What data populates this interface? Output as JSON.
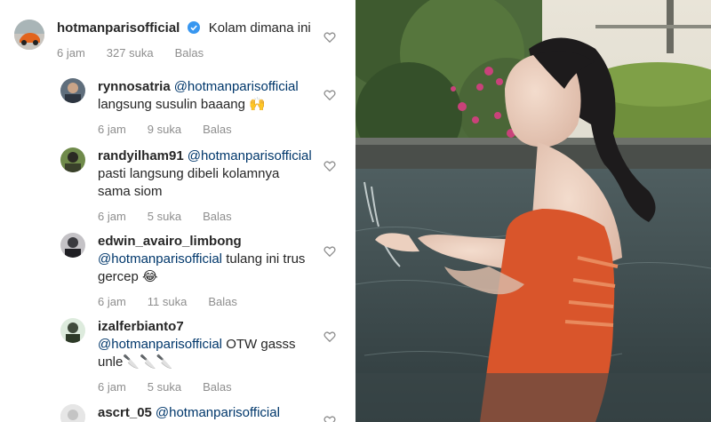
{
  "comments": [
    {
      "username": "hotmanparisofficial",
      "verified": true,
      "mention": "",
      "text": "Kolam dimana ini",
      "time": "6 jam",
      "likes": "327 suka",
      "reply": "Balas",
      "avatar_icon": "car-avatar"
    },
    {
      "username": "rynnosatria",
      "mention": "@hotmanparisofficial",
      "text": "langsung susulin baaang 🙌",
      "time": "6 jam",
      "likes": "9 suka",
      "reply": "Balas"
    },
    {
      "username": "randyilham91",
      "mention": "@hotmanparisofficial",
      "text": "pasti langsung dibeli kolamnya sama siom",
      "time": "6 jam",
      "likes": "5 suka",
      "reply": "Balas"
    },
    {
      "username": "edwin_avairo_limbong",
      "mention": "@hotmanparisofficial",
      "text": "tulang ini trus gercep 😂",
      "time": "6 jam",
      "likes": "11 suka",
      "reply": "Balas"
    },
    {
      "username": "izalferbianto7",
      "mention": "@hotmanparisofficial",
      "text": "OTW gasss unle🔪🔪🔪",
      "time": "6 jam",
      "likes": "5 suka",
      "reply": "Balas"
    },
    {
      "username": "ascrt_05",
      "mention": "@hotmanparisofficial",
      "text": "",
      "time": "",
      "likes": "",
      "reply": ""
    }
  ],
  "colors": {
    "mention": "#00376b",
    "meta": "#8e8e8e",
    "verified": "#3897f0",
    "swimsuit": "#d9552b"
  }
}
